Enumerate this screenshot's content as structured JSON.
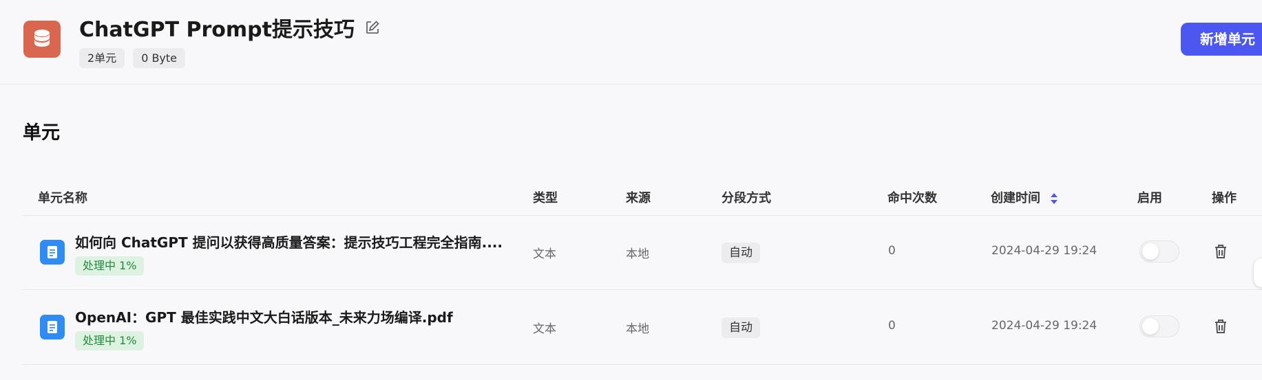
{
  "dataset": {
    "title": "ChatGPT Prompt提示技巧",
    "unit_count": "2单元",
    "size": "0 Byte",
    "icon": "database-icon",
    "edit_icon": "edit-icon"
  },
  "actions": {
    "new_unit_label": "新增单元"
  },
  "section": {
    "title": "单元"
  },
  "table": {
    "headers": {
      "name": "单元名称",
      "type": "类型",
      "source": "来源",
      "segment": "分段方式",
      "hits": "命中次数",
      "created": "创建时间",
      "enabled": "启用",
      "actions": "操作"
    },
    "rows": [
      {
        "name": "如何向 ChatGPT 提问以获得高质量答案：提示技巧工程完全指南....",
        "status": "处理中 1%",
        "type": "文本",
        "source": "本地",
        "segment": "自动",
        "hits": "0",
        "created": "2024-04-29 19:24",
        "enabled": false
      },
      {
        "name": "OpenAI：GPT 最佳实践中文大白话版本_未来力场编译.pdf",
        "status": "处理中 1%",
        "type": "文本",
        "source": "本地",
        "segment": "自动",
        "hits": "0",
        "created": "2024-04-29 19:24",
        "enabled": false
      }
    ]
  },
  "colors": {
    "accent": "#4b57f0",
    "dataset_icon": "#d9674f",
    "file_icon": "#2f8cf5",
    "status_bg": "#ddf2e1",
    "status_text": "#218a3b"
  }
}
